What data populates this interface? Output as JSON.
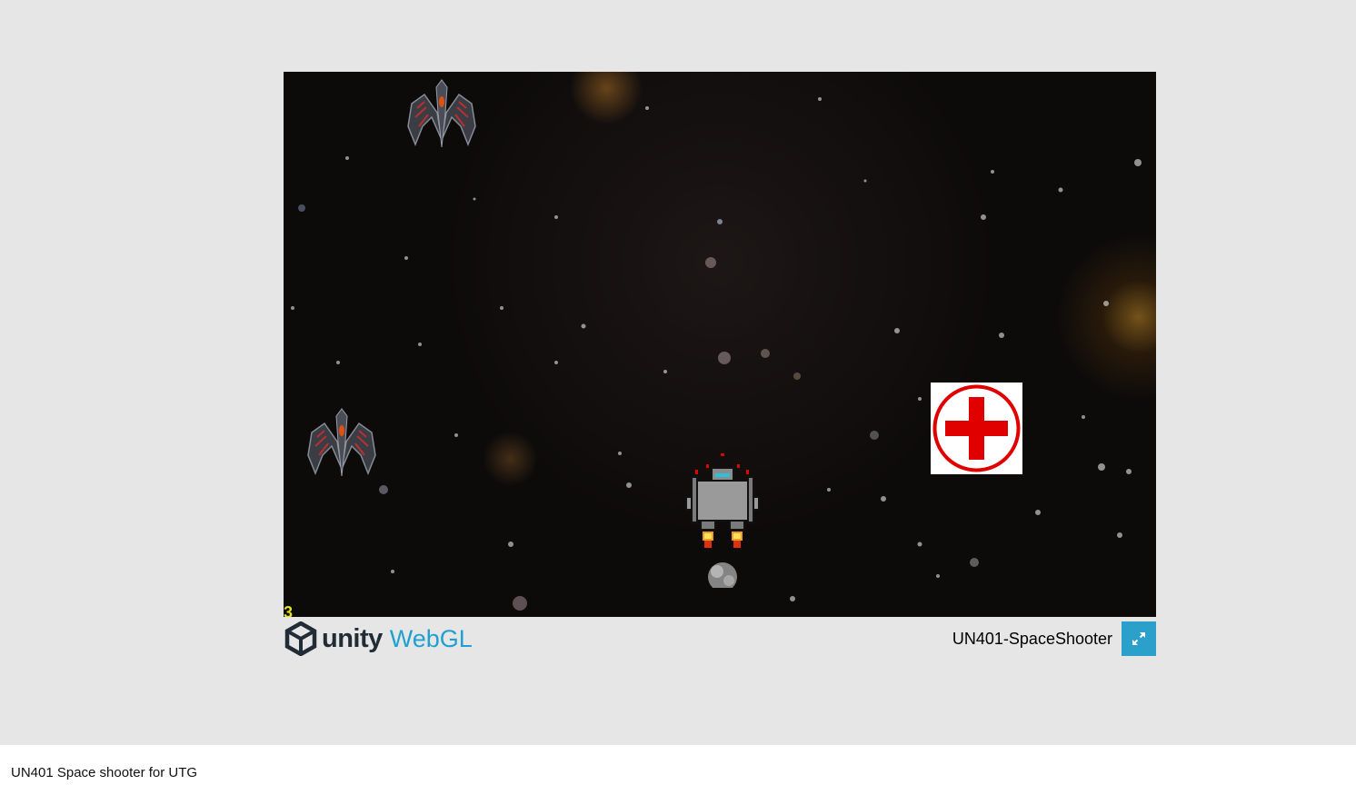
{
  "game": {
    "hud": {
      "lives": "3"
    },
    "sprites": {
      "enemy_ship_icon": "enemy-ship-icon",
      "player_ship_icon": "player-ship-icon",
      "powerup_icon": "health-cross-icon",
      "powerup_color": "#e00000"
    }
  },
  "footer": {
    "brand_unity": "unity",
    "brand_webgl": "WebGL",
    "game_title": "UN401-SpaceShooter",
    "fullscreen_icon": "fullscreen-icon",
    "accent_color": "#2aa0ca"
  },
  "page": {
    "caption": "UN401 Space shooter for UTG"
  }
}
